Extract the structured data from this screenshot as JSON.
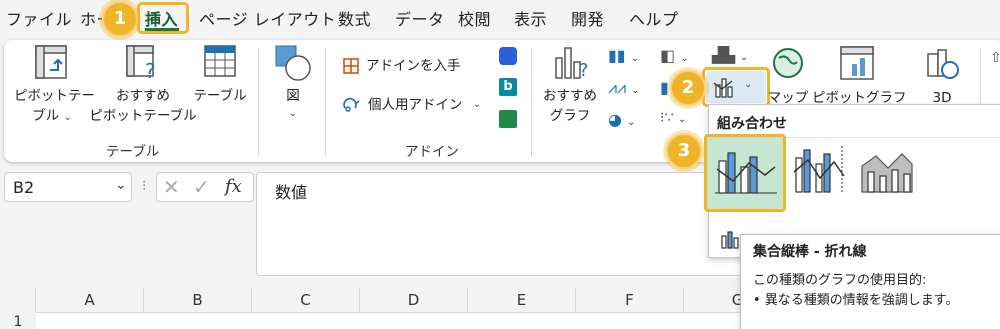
{
  "menu": {
    "file": "ファイル",
    "home": "ホーム",
    "insert": "挿入",
    "page_layout": "ページ レイアウト",
    "formulas": "数式",
    "data": "データ",
    "review": "校閲",
    "view": "表示",
    "developer": "開発",
    "help": "ヘルプ"
  },
  "ribbon": {
    "pivot_table_line1": "ピボットテー",
    "pivot_table_line2": "ブル",
    "recommended_pivot_line1": "おすすめ",
    "recommended_pivot_line2": "ピボットテーブル",
    "table": "テーブル",
    "illustrations": "図",
    "tables_group": "テーブル",
    "get_addins": "アドインを入手",
    "my_addins": "個人用アドイン",
    "addins_group": "アドイン",
    "recommended_charts_line1": "おすすめ",
    "recommended_charts_line2": "グラフ",
    "maps": "マップ",
    "pivot_chart": "ピボットグラフ",
    "three_d": "3D"
  },
  "formula_bar": {
    "name_box": "B2",
    "fx": "fx",
    "value": "数値"
  },
  "dropdown": {
    "section": "組み合わせ"
  },
  "tooltip": {
    "title": "集合縦棒 - 折れ線",
    "line1": "この種類のグラフの使用目的:",
    "line2": "• 異なる種類の情報を強調します。"
  },
  "steps": [
    "1",
    "2",
    "3"
  ],
  "grid": {
    "columns": [
      "A",
      "B",
      "C",
      "D",
      "E",
      "F",
      "G"
    ],
    "first_row": "1"
  },
  "colors": {
    "accent": "#f0b429",
    "excel_green": "#217346",
    "chart_blue": "#5b9bd5",
    "selected_bg": "#c6e6d1"
  }
}
